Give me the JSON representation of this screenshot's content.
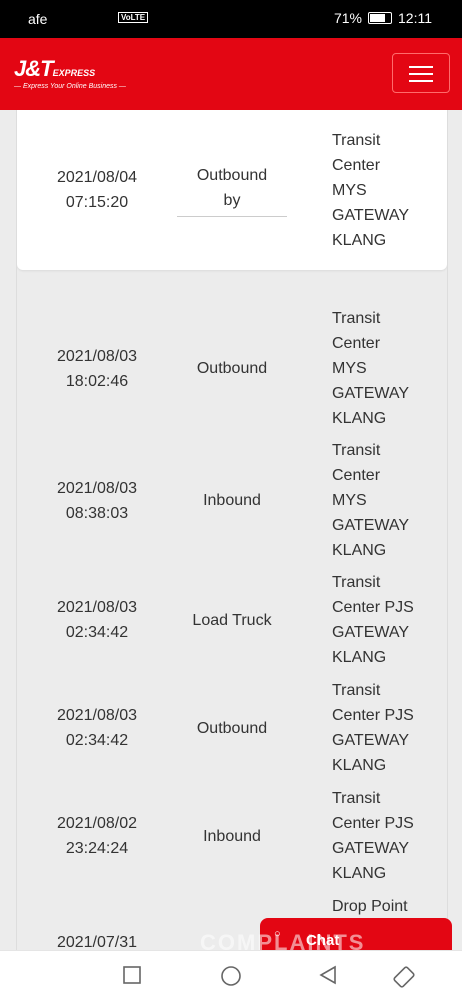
{
  "status": {
    "left": "afe",
    "volte": "VoLTE",
    "battery": "71%",
    "time": "12:11"
  },
  "header": {
    "brand": "J&T",
    "brand_suffix": "EXPRESS",
    "tagline": "— Express Your Online Business —"
  },
  "rows": [
    {
      "date": "2021/08/04",
      "time": "07:15:20",
      "action_l1": "Outbound",
      "action_l2": "by",
      "location": [
        "Transit",
        "Center",
        "MYS",
        "GATEWAY",
        "KLANG"
      ]
    },
    {
      "date": "2021/08/03",
      "time": "18:02:46",
      "action_l1": "Outbound",
      "action_l2": "",
      "location": [
        "Transit",
        "Center",
        "MYS",
        "GATEWAY",
        "KLANG"
      ]
    },
    {
      "date": "2021/08/03",
      "time": "08:38:03",
      "action_l1": "Inbound",
      "action_l2": "",
      "location": [
        "Transit",
        "Center",
        "MYS",
        "GATEWAY",
        "KLANG"
      ]
    },
    {
      "date": "2021/08/03",
      "time": "02:34:42",
      "action_l1": "Load Truck",
      "action_l2": "",
      "location": [
        "Transit",
        "Center PJS",
        "GATEWAY",
        "KLANG"
      ]
    },
    {
      "date": "2021/08/03",
      "time": "02:34:42",
      "action_l1": "Outbound",
      "action_l2": "",
      "location": [
        "Transit",
        "Center PJS",
        "GATEWAY",
        "KLANG"
      ]
    },
    {
      "date": "2021/08/02",
      "time": "23:24:24",
      "action_l1": "Inbound",
      "action_l2": "",
      "location": [
        "Transit",
        "Center PJS",
        "GATEWAY",
        "KLANG"
      ]
    },
    {
      "date": "2021/07/31",
      "time": "",
      "action_l1": "",
      "action_l2": "",
      "location": [
        "Drop Point"
      ]
    }
  ],
  "chat": {
    "label": "Chat"
  },
  "watermark": "COMPLAINTS"
}
